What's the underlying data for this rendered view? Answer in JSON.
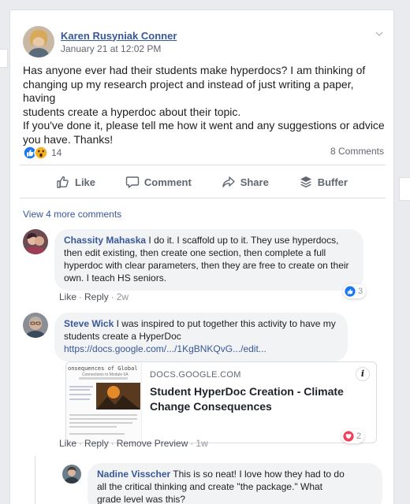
{
  "post": {
    "author": "Karen Rusyniak Conner",
    "timestamp": "January 21 at 12:02 PM",
    "lines": [
      "Has anyone ever had their students make hyperdocs? I am thinking of",
      "changing up my research project and instead of just writing a paper, having",
      "students create a hyperdoc about their topic.",
      "If you've done it, please tell me how it went and any suggestions or advice",
      "you have. Thanks!"
    ],
    "reaction_count": "14",
    "comments_count": "8 Comments"
  },
  "actions": {
    "like": "Like",
    "comment": "Comment",
    "share": "Share",
    "buffer": "Buffer"
  },
  "view_more": "View 4 more comments",
  "comments": [
    {
      "name": "Chassity Mahaska",
      "lines": [
        "I do it. I scaffold up to it. They use hyperdocs,",
        "then edit existing, then create one section, then complete a full",
        "hyperdoc with clear parameters, then they are free to create on their",
        "own. I teach HS seniors."
      ],
      "like": "Like",
      "reply": "Reply",
      "time": "2w",
      "reactions": "3"
    },
    {
      "name": "Steve Wick",
      "lines": [
        "I was inspired to put together this activity to have my",
        "students create a HyperDoc"
      ],
      "link": "https://docs.google.com/.../1KgBNKQvG.../edit...",
      "like": "Like",
      "reply": "Reply",
      "remove_preview": "Remove Preview",
      "time": "1w",
      "reactions": "2"
    },
    {
      "name": "Nadine Visscher",
      "lines": [
        "This is so neat! I love how they had to do",
        "all the critical thinking and create \"the package.\" What",
        "grade level was this?"
      ]
    }
  ],
  "link_preview": {
    "domain": "DOCS.GOOGLE.COM",
    "title_lines": [
      "Student HyperDoc Creation - Climate",
      "Change Consequences"
    ],
    "thumb_heading": "onsequences of Global Climate C",
    "thumb_sub": "Connections to Module 6A",
    "info": "i"
  },
  "colors": {
    "link": "#385898",
    "like_blue": "#1877f2",
    "love_red": "#f33e58",
    "haha_yellow": "#f7b125"
  }
}
